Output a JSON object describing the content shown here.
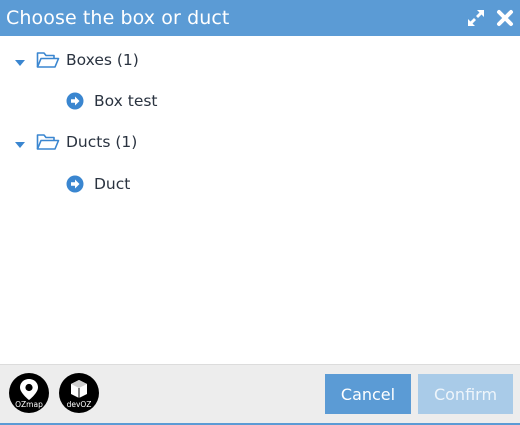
{
  "dialog": {
    "title": "Choose the box or duct",
    "expand_icon": "expand-arrows-icon",
    "close_icon": "close-x-icon"
  },
  "tree": {
    "groups": [
      {
        "label": "Boxes (1)",
        "expanded": true,
        "items": [
          {
            "label": "Box test"
          }
        ]
      },
      {
        "label": "Ducts (1)",
        "expanded": true,
        "items": [
          {
            "label": "Duct"
          }
        ]
      }
    ]
  },
  "footer": {
    "logos": [
      {
        "name": "ozmap-logo",
        "text": "OZmap"
      },
      {
        "name": "devoz-logo",
        "text": "devOZ"
      }
    ],
    "cancel_label": "Cancel",
    "confirm_label": "Confirm",
    "confirm_enabled": false
  },
  "colors": {
    "header": "#5b9bd5",
    "button_primary": "#5b9bd5",
    "button_disabled": "#a9cbe8",
    "footer_bg": "#ededed",
    "text": "#2a3340"
  }
}
